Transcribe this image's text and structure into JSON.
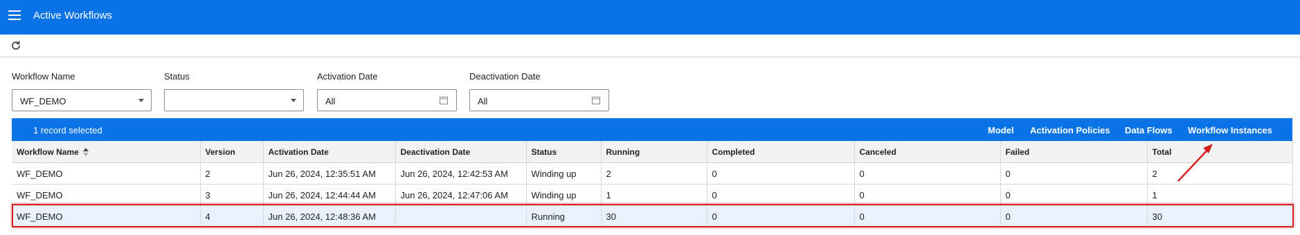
{
  "header": {
    "title": "Active Workflows",
    "menu_icon": "hamburger-menu-icon"
  },
  "toolbar": {
    "refresh_icon": "refresh-icon"
  },
  "filters": {
    "workflow_name": {
      "label": "Workflow Name",
      "value": "WF_DEMO"
    },
    "status": {
      "label": "Status",
      "value": ""
    },
    "activation_date": {
      "label": "Activation Date",
      "value": "All"
    },
    "deactivation_date": {
      "label": "Deactivation Date",
      "value": "All"
    }
  },
  "grid": {
    "selection_text": "1 record selected",
    "links": [
      "Model",
      "Activation Policies",
      "Data Flows",
      "Workflow Instances"
    ],
    "columns": [
      "Workflow Name",
      "Version",
      "Activation Date",
      "Deactivation Date",
      "Status",
      "Running",
      "Completed",
      "Canceled",
      "Failed",
      "Total"
    ],
    "rows": [
      [
        "WF_DEMO",
        "2",
        "Jun 26, 2024, 12:35:51 AM",
        "Jun 26, 2024, 12:42:53 AM",
        "Winding up",
        "2",
        "0",
        "0",
        "0",
        "2"
      ],
      [
        "WF_DEMO",
        "3",
        "Jun 26, 2024, 12:44:44 AM",
        "Jun 26, 2024, 12:47:06 AM",
        "Winding up",
        "1",
        "0",
        "0",
        "0",
        "1"
      ],
      [
        "WF_DEMO",
        "4",
        "Jun 26, 2024, 12:48:36 AM",
        "",
        "Running",
        "30",
        "0",
        "0",
        "0",
        "30"
      ]
    ],
    "selected_row": 2
  },
  "colors": {
    "brand_blue": "#0a74e6",
    "highlight_red": "#d41f1f",
    "selected_row_bg": "#e8f1fc"
  }
}
